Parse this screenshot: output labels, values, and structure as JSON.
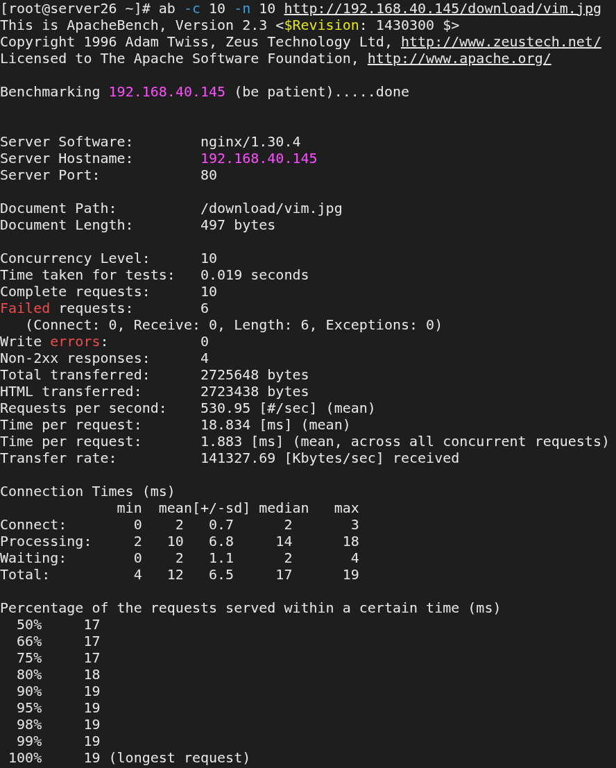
{
  "terminal": {
    "lines": [
      {
        "segments": [
          {
            "kind": "plain",
            "text": "[root@server26 ~]# ab "
          },
          {
            "kind": "option",
            "text": "-c"
          },
          {
            "kind": "plain",
            "text": " 10 "
          },
          {
            "kind": "option",
            "text": "-n"
          },
          {
            "kind": "plain",
            "text": " 10 "
          },
          {
            "kind": "link",
            "text": "http://192.168.40.145/download/vim.jpg"
          }
        ]
      },
      {
        "segments": [
          {
            "kind": "plain",
            "text": "This is ApacheBench, Version 2.3 <"
          },
          {
            "kind": "keyword",
            "text": "$Revision"
          },
          {
            "kind": "plain",
            "text": ": 1430300 $>"
          }
        ]
      },
      {
        "segments": [
          {
            "kind": "plain",
            "text": "Copyright 1996 Adam Twiss, Zeus Technology Ltd, "
          },
          {
            "kind": "link",
            "text": "http://www.zeustech.net/"
          }
        ]
      },
      {
        "segments": [
          {
            "kind": "plain",
            "text": "Licensed to The Apache Software Foundation, "
          },
          {
            "kind": "link",
            "text": "http://www.apache.org/"
          }
        ]
      },
      {
        "kind": "blank"
      },
      {
        "segments": [
          {
            "kind": "plain",
            "text": "Benchmarking "
          },
          {
            "kind": "address",
            "text": "192.168.40.145"
          },
          {
            "kind": "plain",
            "text": " (be patient).....done"
          }
        ]
      },
      {
        "kind": "blank"
      },
      {
        "kind": "blank"
      },
      {
        "segments": [
          {
            "kind": "plain",
            "text": "Server Software:        nginx/1.30.4"
          }
        ]
      },
      {
        "segments": [
          {
            "kind": "plain",
            "text": "Server Hostname:        "
          },
          {
            "kind": "address",
            "text": "192.168.40.145"
          }
        ]
      },
      {
        "segments": [
          {
            "kind": "plain",
            "text": "Server Port:            80"
          }
        ]
      },
      {
        "kind": "blank"
      },
      {
        "segments": [
          {
            "kind": "plain",
            "text": "Document Path:          /download/vim.jpg"
          }
        ]
      },
      {
        "segments": [
          {
            "kind": "plain",
            "text": "Document Length:        497 bytes"
          }
        ]
      },
      {
        "kind": "blank"
      },
      {
        "segments": [
          {
            "kind": "plain",
            "text": "Concurrency Level:      10"
          }
        ]
      },
      {
        "segments": [
          {
            "kind": "plain",
            "text": "Time taken for tests:   0.019 seconds"
          }
        ]
      },
      {
        "segments": [
          {
            "kind": "plain",
            "text": "Complete requests:      10"
          }
        ]
      },
      {
        "segments": [
          {
            "kind": "error",
            "text": "Failed"
          },
          {
            "kind": "plain",
            "text": " requests:        6"
          }
        ]
      },
      {
        "segments": [
          {
            "kind": "plain",
            "text": "   (Connect: 0, Receive: 0, Length: 6, Exceptions: 0)"
          }
        ]
      },
      {
        "segments": [
          {
            "kind": "plain",
            "text": "Write "
          },
          {
            "kind": "error",
            "text": "errors"
          },
          {
            "kind": "plain",
            "text": ":           0"
          }
        ]
      },
      {
        "segments": [
          {
            "kind": "plain",
            "text": "Non-2xx responses:      4"
          }
        ]
      },
      {
        "segments": [
          {
            "kind": "plain",
            "text": "Total transferred:      2725648 bytes"
          }
        ]
      },
      {
        "segments": [
          {
            "kind": "plain",
            "text": "HTML transferred:       2723438 bytes"
          }
        ]
      },
      {
        "segments": [
          {
            "kind": "plain",
            "text": "Requests per second:    530.95 [#/sec] (mean)"
          }
        ]
      },
      {
        "segments": [
          {
            "kind": "plain",
            "text": "Time per request:       18.834 [ms] (mean)"
          }
        ]
      },
      {
        "segments": [
          {
            "kind": "plain",
            "text": "Time per request:       1.883 [ms] (mean, across all concurrent requests)"
          }
        ]
      },
      {
        "segments": [
          {
            "kind": "plain",
            "text": "Transfer rate:          141327.69 [Kbytes/sec] received"
          }
        ]
      },
      {
        "kind": "blank"
      },
      {
        "segments": [
          {
            "kind": "plain",
            "text": "Connection Times (ms)"
          }
        ]
      },
      {
        "segments": [
          {
            "kind": "plain",
            "text": "              min  mean[+/-sd] median   max"
          }
        ]
      },
      {
        "segments": [
          {
            "kind": "plain",
            "text": "Connect:        0    2   0.7      2       3"
          }
        ]
      },
      {
        "segments": [
          {
            "kind": "plain",
            "text": "Processing:     2   10   6.8     14      18"
          }
        ]
      },
      {
        "segments": [
          {
            "kind": "plain",
            "text": "Waiting:        0    2   1.1      2       4"
          }
        ]
      },
      {
        "segments": [
          {
            "kind": "plain",
            "text": "Total:          4   12   6.5     17      19"
          }
        ]
      },
      {
        "kind": "blank"
      },
      {
        "segments": [
          {
            "kind": "plain",
            "text": "Percentage of the requests served within a certain time (ms)"
          }
        ]
      },
      {
        "segments": [
          {
            "kind": "plain",
            "text": "  50%     17"
          }
        ]
      },
      {
        "segments": [
          {
            "kind": "plain",
            "text": "  66%     17"
          }
        ]
      },
      {
        "segments": [
          {
            "kind": "plain",
            "text": "  75%     17"
          }
        ]
      },
      {
        "segments": [
          {
            "kind": "plain",
            "text": "  80%     18"
          }
        ]
      },
      {
        "segments": [
          {
            "kind": "plain",
            "text": "  90%     19"
          }
        ]
      },
      {
        "segments": [
          {
            "kind": "plain",
            "text": "  95%     19"
          }
        ]
      },
      {
        "segments": [
          {
            "kind": "plain",
            "text": "  98%     19"
          }
        ]
      },
      {
        "segments": [
          {
            "kind": "plain",
            "text": "  99%     19"
          }
        ]
      },
      {
        "segments": [
          {
            "kind": "plain",
            "text": " 100%     19 (longest request)"
          }
        ]
      }
    ]
  }
}
